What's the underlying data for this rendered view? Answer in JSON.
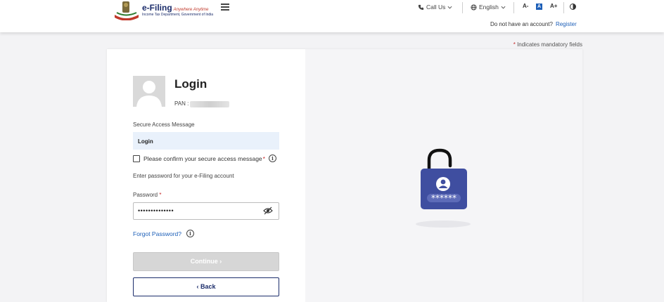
{
  "header": {
    "brand": "e-Filing",
    "tagline": "Anywhere Anytime",
    "department": "Income Tax Department, Government of India",
    "call_us": "Call Us",
    "language": "English",
    "font_small": "A-",
    "font_normal": "A",
    "font_large": "A+",
    "no_account": "Do not have an account?",
    "register": "Register"
  },
  "mandatory": {
    "star": "*",
    "text": "Indicates mandatory fields"
  },
  "login": {
    "title": "Login",
    "pan_label": "PAN :",
    "secure_access_label": "Secure Access Message",
    "secure_access_value": "Login",
    "confirm_text": "Please confirm your secure access message",
    "required_star": "*",
    "info_glyph": "i",
    "enter_password_text": "Enter password for your e-Filing account",
    "password_label": "Password",
    "password_value": "••••••••••••••",
    "forgot_password": "Forgot Password?",
    "continue_label": "Continue  ›",
    "back_label": "‹  Back"
  },
  "colors": {
    "brand_blue": "#1c2d6b",
    "link_blue": "#1d5fb8",
    "lock_body": "#3f4ea0",
    "required_red": "#c62828"
  }
}
